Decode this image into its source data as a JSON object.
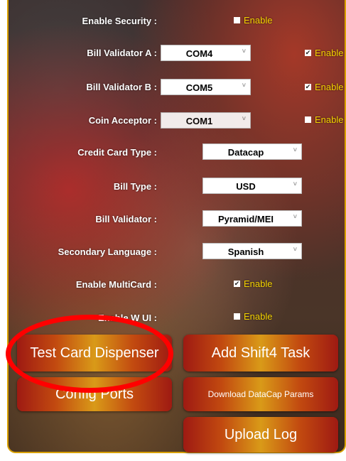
{
  "settings": {
    "enable_security": {
      "label": "Enable Security :",
      "checkbox_label": "Enable",
      "checked": false
    },
    "bill_validator_a": {
      "label": "Bill Validator A :",
      "value": "COM4",
      "checkbox_label": "Enable",
      "checked": true
    },
    "bill_validator_b": {
      "label": "Bill Validator B :",
      "value": "COM5",
      "checkbox_label": "Enable",
      "checked": true
    },
    "coin_acceptor": {
      "label": "Coin Acceptor :",
      "value": "COM1",
      "checkbox_label": "Enable",
      "checked": false
    },
    "credit_card_type": {
      "label": "Credit Card Type :",
      "value": "Datacap"
    },
    "bill_type": {
      "label": "Bill Type :",
      "value": "USD"
    },
    "bill_validator": {
      "label": "Bill Validator :",
      "value": "Pyramid/MEI"
    },
    "secondary_language": {
      "label": "Secondary Language :",
      "value": "Spanish"
    },
    "enable_multicard": {
      "label": "Enable MultiCard :",
      "checkbox_label": "Enable",
      "checked": true
    },
    "enable_web_ui": {
      "label": "Enable W   UI :",
      "checkbox_label": "Enable",
      "checked": false
    }
  },
  "buttons": {
    "test_card_dispenser": "Test Card Dispenser",
    "add_shift4_task": "Add Shift4 Task",
    "config_ports": "Config Ports",
    "download_datacap_params": "Download DataCap Params",
    "upload_log": "Upload Log"
  },
  "glyphs": {
    "chevron": "˅",
    "check": "✔"
  },
  "colors": {
    "enable_text": "#f5d300",
    "border": "#d8a000",
    "highlight_ring": "#ff0000"
  }
}
